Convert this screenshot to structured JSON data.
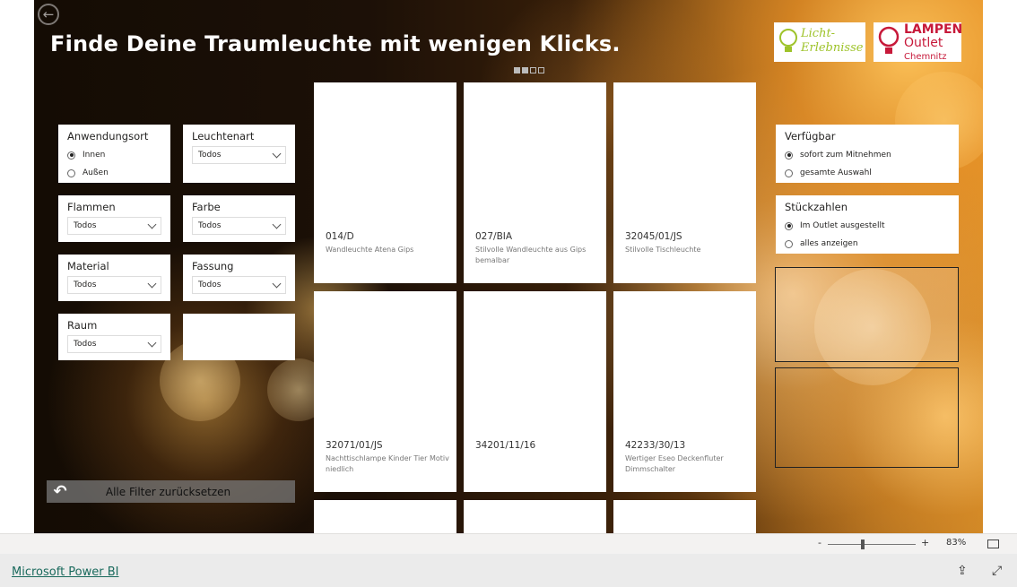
{
  "report": {
    "title": "Finde Deine Traumleuchte mit wenigen Klicks.",
    "logos": {
      "licht": "Licht-Erlebnisse",
      "lampen_line1": "LAMPEN",
      "lampen_line2": "Outlet",
      "lampen_line3": "Chemnitz"
    }
  },
  "filters": {
    "anwendungsort": {
      "title": "Anwendungsort",
      "options": [
        "Innen",
        "Außen"
      ],
      "selected": "Innen"
    },
    "leuchtenart": {
      "title": "Leuchtenart",
      "value": "Todos"
    },
    "flammen": {
      "title": "Flammen",
      "value": "Todos"
    },
    "farbe": {
      "title": "Farbe",
      "value": "Todos"
    },
    "material": {
      "title": "Material",
      "value": "Todos"
    },
    "fassung": {
      "title": "Fassung",
      "value": "Todos"
    },
    "raum": {
      "title": "Raum",
      "value": "Todos"
    },
    "verfuegbar": {
      "title": "Verfügbar",
      "options": [
        "sofort zum Mitnehmen",
        "gesamte Auswahl"
      ],
      "selected": "sofort zum Mitnehmen"
    },
    "stueckzahlen": {
      "title": "Stückzahlen",
      "options": [
        "Im Outlet ausgestellt",
        "alles anzeigen"
      ],
      "selected": "Im Outlet ausgestellt"
    },
    "reset_label": "Alle Filter zurücksetzen"
  },
  "products": [
    {
      "code": "014/D",
      "desc": "Wandleuchte Atena Gips"
    },
    {
      "code": "027/BIA",
      "desc": "Stilvolle Wandleuchte aus Gips bemalbar"
    },
    {
      "code": "32045/01/JS",
      "desc": "Stilvolle Tischleuchte"
    },
    {
      "code": "32071/01/JS",
      "desc": "Nachttischlampe Kinder Tier Motiv niedlich"
    },
    {
      "code": "34201/11/16",
      "desc": ""
    },
    {
      "code": "42233/30/13",
      "desc": "Wertiger Eseo Deckenfluter Dimmschalter"
    }
  ],
  "statusbar": {
    "zoom_minus": "-",
    "zoom_plus": "+",
    "zoom_level": "83%"
  },
  "footer": {
    "link": "Microsoft Power BI"
  },
  "icons": [
    "back-arrow-icon",
    "reset-icon",
    "fit-to-page-icon",
    "share-icon",
    "fullscreen-icon"
  ]
}
